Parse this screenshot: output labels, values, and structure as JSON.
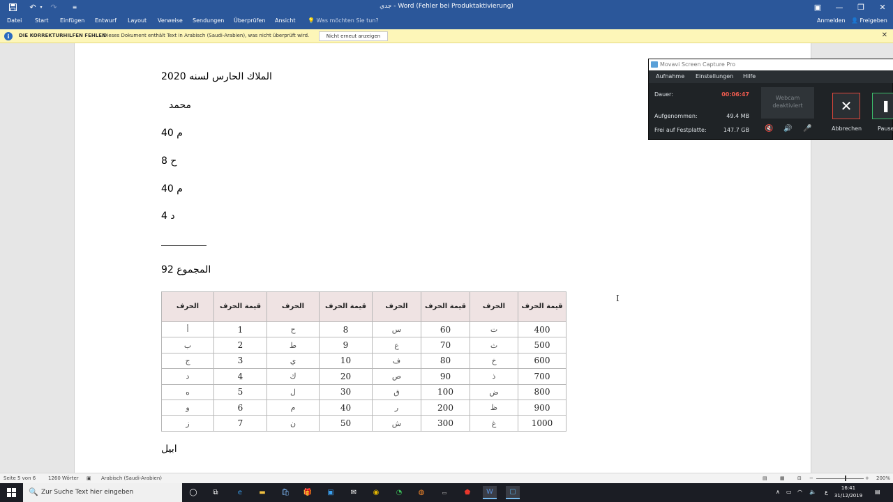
{
  "window": {
    "title": "جدي - Word (Fehler bei Produktaktivierung)",
    "buttons": {
      "ribbon_display": "▣",
      "minimize": "—",
      "restore": "❐",
      "close": "✕"
    }
  },
  "quick_access": {
    "save_icon": "💾",
    "undo_icon": "↶",
    "redo_icon": "↷",
    "customize_icon": "≡"
  },
  "ribbon": {
    "tabs": [
      "Datei",
      "Start",
      "Einfügen",
      "Entwurf",
      "Layout",
      "Verweise",
      "Sendungen",
      "Überprüfen",
      "Ansicht"
    ],
    "tell_me": "Was möchten Sie tun?",
    "sign_in": "Anmelden",
    "share": "Freigeben"
  },
  "infobar": {
    "title": "DIE KORREKTURHILFEN FEHLEN",
    "message": "Dieses Dokument enthält Text in Arabisch (Saudi-Arabien), was nicht überprüft wird.",
    "button": "Nicht erneut anzeigen",
    "close": "✕"
  },
  "document": {
    "lines": [
      "الملاك الحارس لسنه 2020",
      "محمد",
      "م  40",
      "ح   8",
      "م  40",
      "د   4",
      "المجموع 92",
      "ابيل"
    ],
    "table": {
      "headers": [
        "قيمة الحرف",
        "الحرف",
        "قيمة الحرف",
        "الحرف",
        "قيمة الحرف",
        "الحرف",
        "قيمة الحرف",
        "الحرف"
      ],
      "rows": [
        [
          "400",
          "ت",
          "60",
          "س",
          "8",
          "ح",
          "1",
          "أ"
        ],
        [
          "500",
          "ث",
          "70",
          "ع",
          "9",
          "ط",
          "2",
          "ب"
        ],
        [
          "600",
          "خ",
          "80",
          "ف",
          "10",
          "ي",
          "3",
          "ج"
        ],
        [
          "700",
          "ذ",
          "90",
          "ص",
          "20",
          "ك",
          "4",
          "د"
        ],
        [
          "800",
          "ض",
          "100",
          "ق",
          "30",
          "ل",
          "5",
          "ه"
        ],
        [
          "900",
          "ظ",
          "200",
          "ر",
          "40",
          "م",
          "6",
          "و"
        ],
        [
          "1000",
          "غ",
          "300",
          "ش",
          "50",
          "ن",
          "7",
          "ز"
        ]
      ]
    }
  },
  "movavi": {
    "title": "Movavi Screen Capture Pro",
    "menu": [
      "Aufnahme",
      "Einstellungen",
      "Hilfe"
    ],
    "duration_label": "Dauer:",
    "duration": "00:06:47",
    "recorded_label": "Aufgenommen:",
    "recorded": "49.4 MB",
    "free_label": "Frei auf Festplatte:",
    "free": "147.7 GB",
    "webcam": "Webcam deaktiviert",
    "cancel": "Abbrechen",
    "pause": "Pause"
  },
  "statusbar": {
    "page": "Seite 5 von 6",
    "words": "1260 Wörter",
    "language": "Arabisch (Saudi-Arabien)",
    "zoom": "200%"
  },
  "taskbar": {
    "search_placeholder": "Zur Suche Text hier eingeben",
    "time": "16:41",
    "date": "31/12/2019",
    "input_lang": "ع"
  },
  "colors": {
    "word_blue": "#2b579a",
    "infobar": "#fdf6b8",
    "movavi_dark": "#1f2326",
    "duration_red": "#f05b4f"
  }
}
